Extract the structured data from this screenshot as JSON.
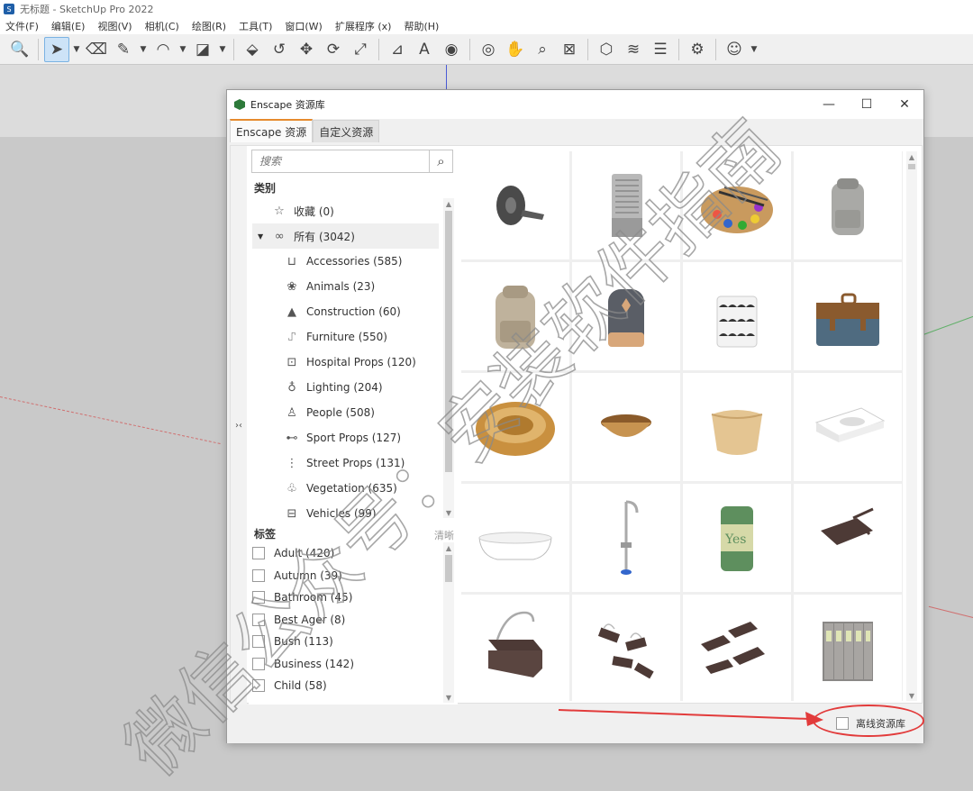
{
  "app": {
    "title": "无标题 - SketchUp Pro 2022",
    "menu": [
      "文件(F)",
      "编辑(E)",
      "视图(V)",
      "相机(C)",
      "绘图(R)",
      "工具(T)",
      "窗口(W)",
      "扩展程序 (x)",
      "帮助(H)"
    ]
  },
  "toolbar": {
    "tools": [
      {
        "name": "zoom-extents-icon",
        "glyph": "🔍"
      },
      {
        "name": "select-icon",
        "glyph": "➤",
        "selected": true
      },
      {
        "name": "eraser-icon",
        "glyph": "⌫"
      },
      {
        "name": "pencil-icon",
        "glyph": "✎"
      },
      {
        "name": "arc-icon",
        "glyph": "◠"
      },
      {
        "name": "rectangle-icon",
        "glyph": "◪"
      },
      {
        "name": "push-pull-icon",
        "glyph": "⬙"
      },
      {
        "name": "follow-me-icon",
        "glyph": "↺"
      },
      {
        "name": "move-icon",
        "glyph": "✥"
      },
      {
        "name": "rotate-icon",
        "glyph": "⟳"
      },
      {
        "name": "scale-icon",
        "glyph": "⤢"
      },
      {
        "name": "tape-measure-icon",
        "glyph": "⊿"
      },
      {
        "name": "text-icon",
        "glyph": "A"
      },
      {
        "name": "paint-bucket-icon",
        "glyph": "◉"
      },
      {
        "name": "orbit-icon",
        "glyph": "◎"
      },
      {
        "name": "pan-icon",
        "glyph": "✋"
      },
      {
        "name": "zoom-icon",
        "glyph": "⌕"
      },
      {
        "name": "zoom-window-icon",
        "glyph": "⊠"
      },
      {
        "name": "warehouse-icon",
        "glyph": "⬡"
      },
      {
        "name": "extension-icon",
        "glyph": "≋"
      },
      {
        "name": "layers-icon",
        "glyph": "☰"
      },
      {
        "name": "extension-manager-icon",
        "glyph": "⚙"
      },
      {
        "name": "account-icon",
        "glyph": "☺"
      }
    ]
  },
  "dialog": {
    "title": "Enscape 资源库",
    "tabs": [
      "Enscape 资源",
      "自定义资源"
    ],
    "search_placeholder": "搜索",
    "categories_label": "类别",
    "favorites": "收藏 (0)",
    "all": "所有 (3042)",
    "categories": [
      {
        "label": "Accessories (585)",
        "icon": "⊔"
      },
      {
        "label": "Animals (23)",
        "icon": "❀"
      },
      {
        "label": "Construction (60)",
        "icon": "▲"
      },
      {
        "label": "Furniture (550)",
        "icon": "⑀"
      },
      {
        "label": "Hospital Props (120)",
        "icon": "⊡"
      },
      {
        "label": "Lighting (204)",
        "icon": "♁"
      },
      {
        "label": "People (508)",
        "icon": "♙"
      },
      {
        "label": "Sport Props (127)",
        "icon": "⊷"
      },
      {
        "label": "Street Props (131)",
        "icon": "⋮"
      },
      {
        "label": "Vegetation (635)",
        "icon": "♧"
      },
      {
        "label": "Vehicles (99)",
        "icon": "⊟"
      }
    ],
    "tags_label": "标签",
    "clear_label": "清晰",
    "tags": [
      "Adult (420)",
      "Autumn (39)",
      "Bathroom (45)",
      "Best Ager (8)",
      "Bush (113)",
      "Business (142)",
      "Child (58)"
    ],
    "offline_label": "离线资源库",
    "assets": [
      "tape-roll",
      "air-cooler",
      "paint-palette",
      "backpack-grey",
      "backpack-beige",
      "backpack-dark",
      "laundry-basket",
      "leather-briefcase",
      "wicker-basket",
      "wooden-bowl",
      "woven-planter",
      "wash-basin",
      "bathtub",
      "shower-faucet",
      "soda-can",
      "binder-clip",
      "binder-clip-large",
      "binder-clips-group",
      "paper-clips-group",
      "file-folders"
    ]
  },
  "watermark": "微信公众号：安装软件指南",
  "colors": {
    "accent_tab": "#e68a2e",
    "annotation_red": "#e23b3b",
    "enscape_green": "#2d7a3a"
  }
}
